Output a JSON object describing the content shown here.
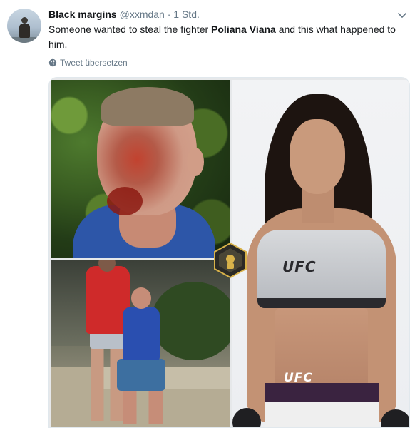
{
  "tweet": {
    "author_name": "Black margins",
    "author_handle": "@xxmdan",
    "separator": "·",
    "timestamp": "1 Std.",
    "text_before": "Someone wanted to steal the fighter ",
    "text_bold": "Poliana Viana",
    "text_after": " and this what happened to him.",
    "translate_label": "Tweet übersetzen"
  },
  "media": {
    "photos": [
      {
        "name": "injured-man-closeup"
      },
      {
        "name": "street-scene"
      },
      {
        "name": "fighter-portrait"
      }
    ],
    "fighter_top_logo": "UFC",
    "fighter_shorts_logo": "UFC"
  },
  "icons": {
    "menu": "chevron-down-icon",
    "translate": "globe-icon",
    "badge": "hexagon-badge-icon"
  },
  "colors": {
    "text": "#14171a",
    "muted": "#657786",
    "border": "#e1e8ed"
  }
}
